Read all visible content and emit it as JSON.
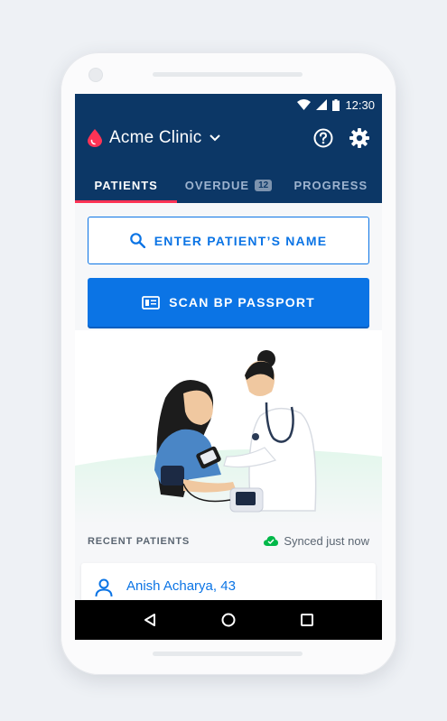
{
  "status_bar": {
    "time": "12:30"
  },
  "app_bar": {
    "title": "Acme Clinic",
    "tabs": [
      {
        "label": "PATIENTS",
        "active": true
      },
      {
        "label": "OVERDUE",
        "badge": "12",
        "active": false
      },
      {
        "label": "PROGRESS",
        "active": false
      }
    ]
  },
  "actions": {
    "search_label": "ENTER PATIENT’S NAME",
    "scan_label": "SCAN BP PASSPORT"
  },
  "recent": {
    "header": "RECENT PATIENTS",
    "sync_status": "Synced just now",
    "patients": [
      {
        "name": "Anish Acharya, 43"
      }
    ]
  },
  "icons": {
    "logo": "blood-drop-icon",
    "help": "help-circle-icon",
    "settings": "gear-icon",
    "search": "search-icon",
    "scan": "id-card-icon",
    "synced": "cloud-check-icon",
    "patient": "person-icon",
    "back": "back-triangle-icon",
    "home": "home-circle-icon",
    "recents": "recents-square-icon"
  },
  "colors": {
    "app_bar": "#0c3766",
    "primary": "#0b74e5",
    "tab_indicator": "#ff3355",
    "logo_red": "#ff3355",
    "sync_green": "#00b849"
  }
}
